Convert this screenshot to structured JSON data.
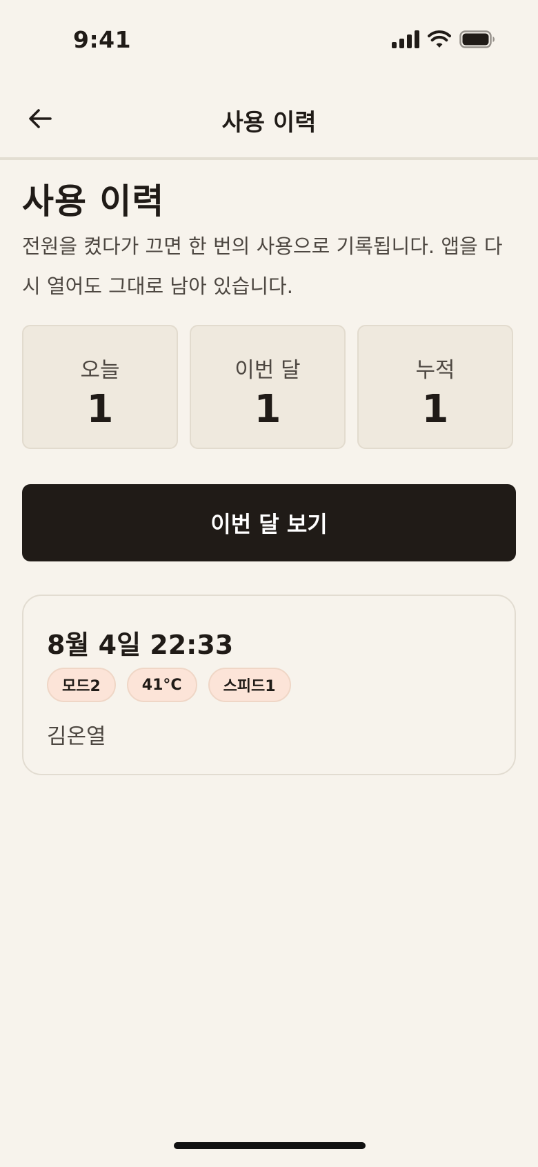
{
  "status_bar": {
    "time": "9:41",
    "icons": [
      "signal-icon",
      "wifi-icon",
      "battery-icon"
    ]
  },
  "nav": {
    "back_icon": "arrow-left-icon",
    "title": "사용 이력"
  },
  "page": {
    "title": "사용 이력",
    "description": "전원을 켰다가 끄면 한 번의 사용으로 기록됩니다. 앱을 다시 열어도 그대로 남아 있습니다."
  },
  "stats": [
    {
      "label": "오늘",
      "value": "1"
    },
    {
      "label": "이번 달",
      "value": "1"
    },
    {
      "label": "누적",
      "value": "1"
    }
  ],
  "month_button_label": "이번 달 보기",
  "records": [
    {
      "datetime": "8월 4일 22:33",
      "tags": [
        "모드2",
        "41°C",
        "스피드1"
      ],
      "user": "김온열"
    }
  ],
  "colors": {
    "background": "#F7F3EC",
    "text": "#201B17",
    "card": "#EFE9DE",
    "button": "#201B17",
    "tag": "#FCE4D8"
  }
}
